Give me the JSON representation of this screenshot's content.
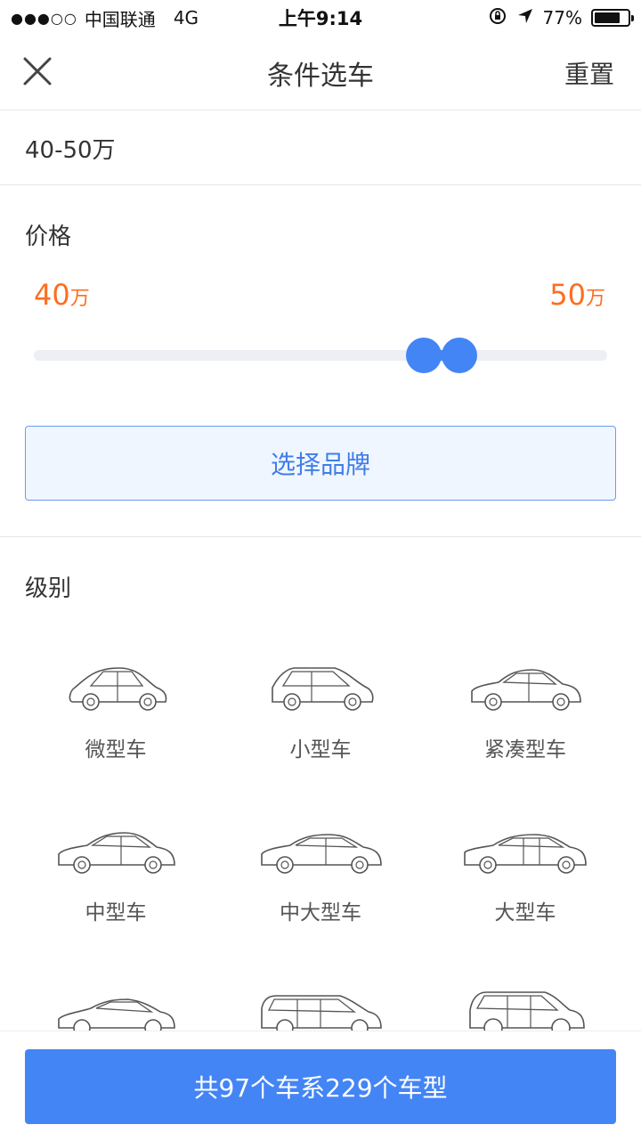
{
  "statusbar": {
    "signal": "●●●○○",
    "carrier": "中国联通",
    "network": "4G",
    "time": "上午9:14",
    "battery_percent": "77%",
    "battery_level": 0.77
  },
  "nav": {
    "title": "条件选车",
    "reset_label": "重置"
  },
  "summary": {
    "text": "40-50万"
  },
  "price": {
    "title": "价格",
    "min_value": "40",
    "max_value": "50",
    "unit": "万"
  },
  "brand": {
    "label": "选择品牌"
  },
  "grade": {
    "title": "级别",
    "items": [
      {
        "label": "微型车",
        "icon": "micro-car-icon"
      },
      {
        "label": "小型车",
        "icon": "small-car-icon"
      },
      {
        "label": "紧凑型车",
        "icon": "compact-car-icon"
      },
      {
        "label": "中型车",
        "icon": "midsize-car-icon"
      },
      {
        "label": "中大型车",
        "icon": "large-midsize-car-icon"
      },
      {
        "label": "大型车",
        "icon": "large-car-icon"
      },
      {
        "label": "",
        "icon": "sports-car-icon"
      },
      {
        "label": "",
        "icon": "wagon-car-icon"
      },
      {
        "label": "",
        "icon": "suv-car-icon"
      }
    ]
  },
  "footer": {
    "submit_label": "共97个车系229个车型"
  },
  "colors": {
    "accent_blue": "#4485f5",
    "price_orange": "#fd6e1f"
  }
}
